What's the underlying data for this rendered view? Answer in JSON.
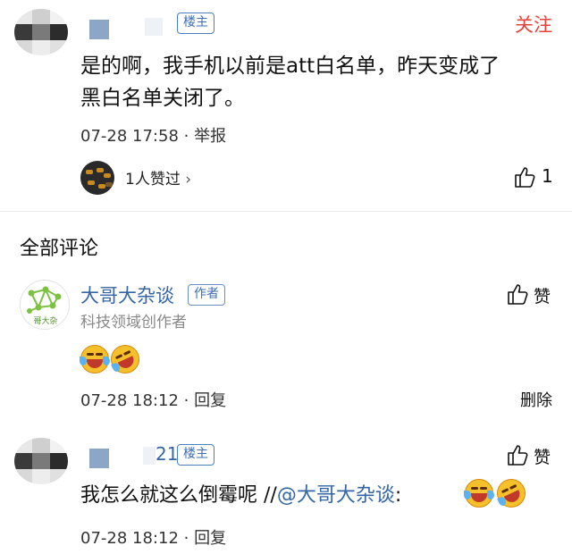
{
  "top_comment": {
    "username_fragment": "",
    "op_badge": "楼主",
    "follow_label": "关注",
    "text_line1": "是的啊，我手机以前是att白名单，昨天变成了",
    "text_line2": "黑白名单关闭了。",
    "timestamp": "07-28 17:58",
    "report_label": "举报",
    "liked_by_text": "1人赞过",
    "like_count": "1"
  },
  "section": {
    "title": "全部评论"
  },
  "author_comment": {
    "name": "大哥大杂谈",
    "author_badge": "作者",
    "description": "科技领域创作者",
    "avatar_text": "哥大杂",
    "praise_label": "赞",
    "timestamp": "07-28 18:12",
    "reply_label": "回复",
    "delete_label": "删除"
  },
  "reply_comment": {
    "username_fragment": "21",
    "op_badge": "楼主",
    "praise_label": "赞",
    "text": "我怎么就这么倒霉呢 //",
    "mention": "@大哥大杂谈",
    "text_after": ":",
    "timestamp": "07-28 18:12",
    "reply_label": "回复"
  },
  "colors": {
    "link_blue": "#3466a6",
    "follow_red": "#e8413b",
    "meta_gray": "#888888"
  }
}
